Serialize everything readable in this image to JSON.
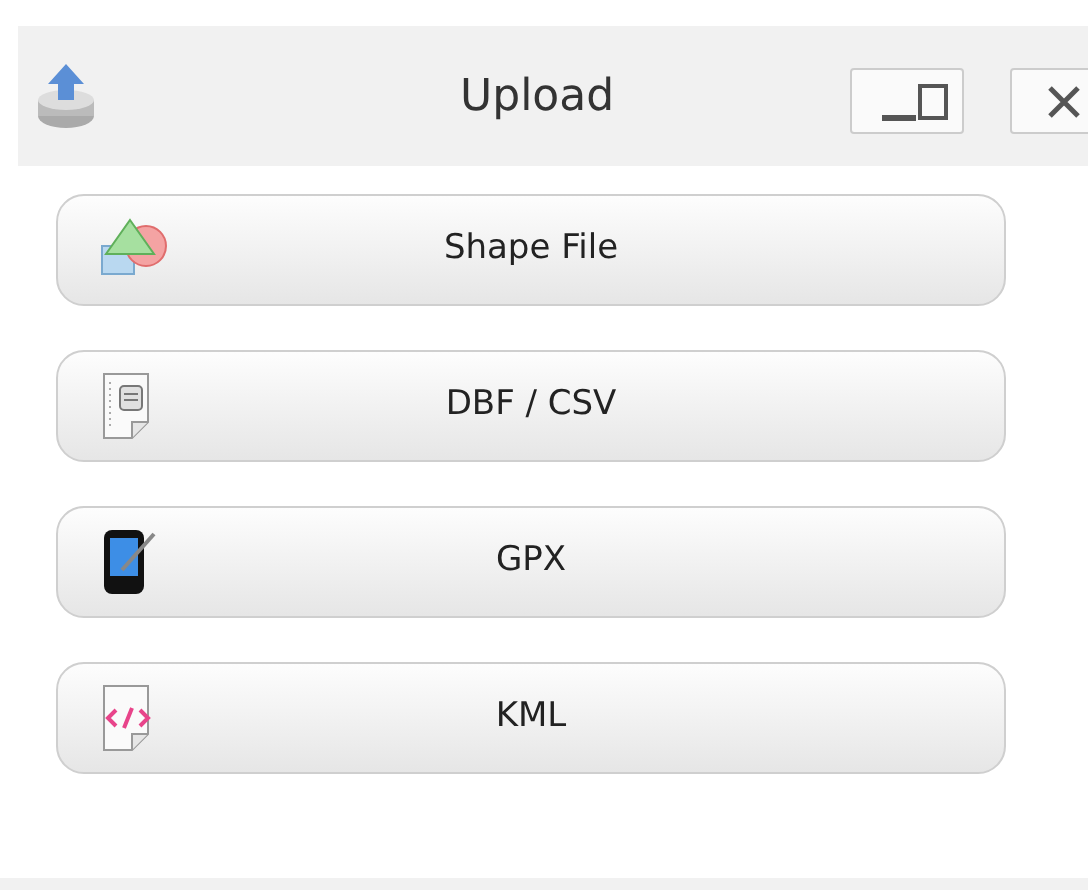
{
  "window": {
    "title": "Upload"
  },
  "buttons": [
    {
      "kind": "shape",
      "label": "Shape File"
    },
    {
      "kind": "table",
      "label": "DBF / CSV"
    },
    {
      "kind": "device",
      "label": "GPX"
    },
    {
      "kind": "code",
      "label": "KML"
    }
  ]
}
